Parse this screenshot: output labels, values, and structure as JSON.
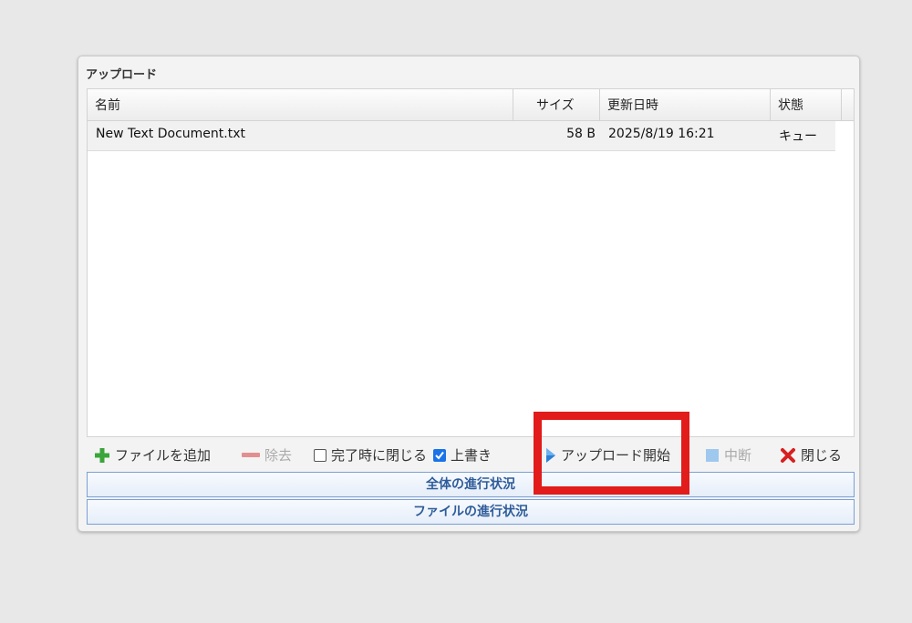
{
  "dialog": {
    "title": "アップロード"
  },
  "grid": {
    "columns": {
      "name": "名前",
      "size": "サイズ",
      "modified": "更新日時",
      "status": "状態"
    },
    "rows": [
      {
        "name": "New Text Document.txt",
        "size": "58 B",
        "modified": "2025/8/19 16:21",
        "status": "キュー"
      }
    ]
  },
  "toolbar": {
    "add_files": "ファイルを追加",
    "remove": "除去",
    "close_on_complete": "完了時に閉じる",
    "close_on_complete_checked": false,
    "overwrite": "上書き",
    "overwrite_checked": true,
    "start_upload": "アップロード開始",
    "abort": "中断",
    "close": "閉じる"
  },
  "progress": {
    "overall_label": "全体の進行状況",
    "file_label": "ファイルの進行状況"
  },
  "colors": {
    "highlight": "#e21b1b",
    "progress_text": "#2e5c99",
    "add_green": "#3aa53a",
    "close_red": "#d62020"
  }
}
